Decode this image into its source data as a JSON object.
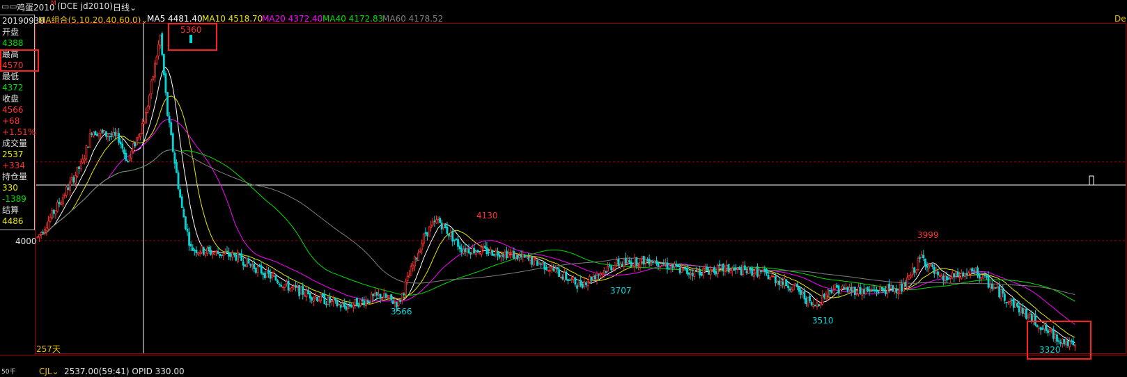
{
  "header": {
    "contract_label": "鸡蛋2010",
    "contract_mark": "M",
    "contract_code": "(DCE jd2010)",
    "period": "日线",
    "period_icon": "chevron-down-icon"
  },
  "ma_legend": {
    "group": "MA组合(5,10,20,40,60,0)",
    "items": [
      {
        "label": "MA5",
        "value": "4481.40",
        "color": "#ffffff"
      },
      {
        "label": "MA10",
        "value": "4518.70",
        "color": "#e8e800"
      },
      {
        "label": "MA20",
        "value": "4372.40",
        "color": "#ff00ff"
      },
      {
        "label": "MA40",
        "value": "4172.83",
        "color": "#00e000"
      },
      {
        "label": "MA60",
        "value": "4178.52",
        "color": "#808080"
      }
    ],
    "right_text": "De"
  },
  "info_panel": {
    "date": "20190930",
    "open_label": "开盘",
    "open": "4388",
    "high_label": "最高",
    "high": "4570",
    "low_label": "最低",
    "low": "4372",
    "close_label": "收盘",
    "close": "4566",
    "change": "+68",
    "change_pct": "+1.51%",
    "volume_label": "成交量",
    "volume": "2537",
    "volume_change": "+334",
    "oi_label": "持仓量",
    "oi": "330",
    "oi_change": "-1389",
    "settle_label": "结算",
    "settle": "4486"
  },
  "price_axis_label": "4000",
  "days_label": "257天",
  "annotations": {
    "peak_high": "5360",
    "mid_high": "4130",
    "right_high": "3999",
    "low1": "3566",
    "low2": "3707",
    "low3": "3510",
    "low4": "3320"
  },
  "bottom": {
    "indicator": "CJL",
    "values": "2537.00(59:41)  OPID 330.00",
    "axis_stub": "50千"
  },
  "colors": {
    "up": "#ff3030",
    "down": "#00d8d8",
    "grid_dash": "#a00000",
    "crosshair": "#ffffff",
    "highlight": "#ff2020"
  },
  "chart_data": {
    "type": "candlestick",
    "annotations_prices": [
      5360,
      4130,
      3999,
      3566,
      3707,
      3510,
      3320
    ],
    "reference_price": 4000,
    "ma_periods": [
      5,
      10,
      20,
      40,
      60
    ],
    "ma_last_values": [
      4481.4,
      4518.7,
      4372.4,
      4172.83,
      4178.52
    ]
  }
}
